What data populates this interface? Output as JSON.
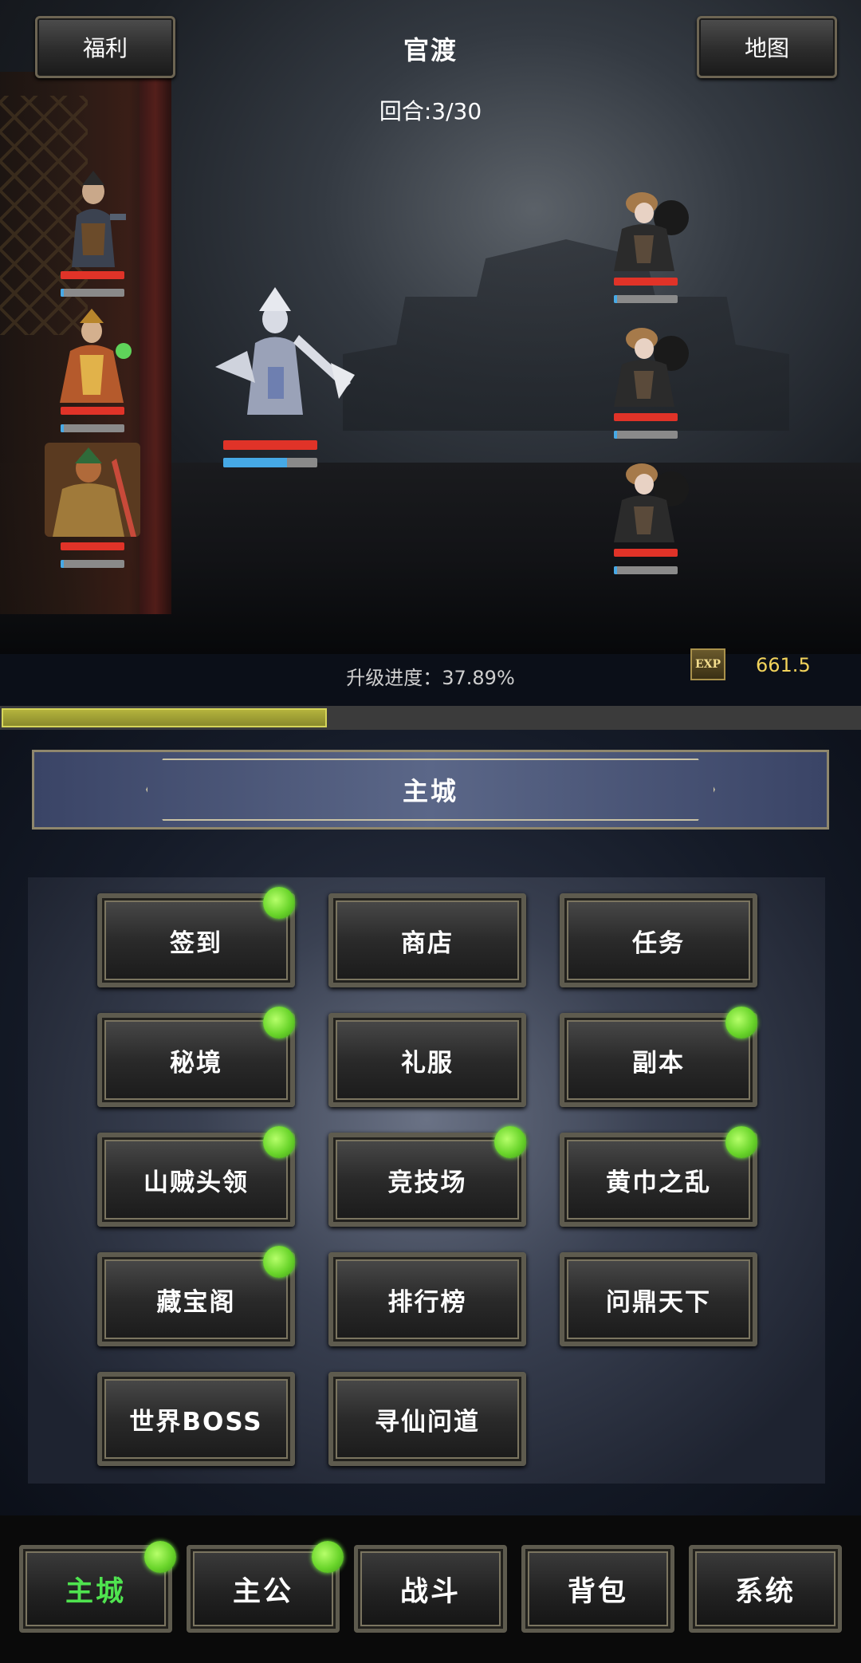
{
  "header": {
    "left_button": "福利",
    "title": "官渡",
    "round": "回合:3/30",
    "right_button": "地图"
  },
  "battle": {
    "left_units": [
      {
        "hp": 1.0,
        "mp": 0.05
      },
      {
        "hp": 1.0,
        "mp": 0.05
      },
      {
        "hp": 1.0,
        "mp": 0.05
      }
    ],
    "main_unit": {
      "hp": 1.0,
      "mp": 0.68
    },
    "right_units": [
      {
        "hp": 1.0,
        "mp": 0.05
      },
      {
        "hp": 1.0,
        "mp": 0.05
      },
      {
        "hp": 1.0,
        "mp": 0.05
      }
    ]
  },
  "progress": {
    "label": "升级进度：37.89%",
    "fraction": 0.3789,
    "exp_icon_text": "EXP",
    "exp_value": "661.5"
  },
  "panel": {
    "title": "主城",
    "buttons": [
      {
        "label": "签到",
        "badge": true
      },
      {
        "label": "商店",
        "badge": false
      },
      {
        "label": "任务",
        "badge": false
      },
      {
        "label": "秘境",
        "badge": true
      },
      {
        "label": "礼服",
        "badge": false
      },
      {
        "label": "副本",
        "badge": true
      },
      {
        "label": "山贼头领",
        "badge": true
      },
      {
        "label": "竞技场",
        "badge": true
      },
      {
        "label": "黄巾之乱",
        "badge": true
      },
      {
        "label": "藏宝阁",
        "badge": true
      },
      {
        "label": "排行榜",
        "badge": false
      },
      {
        "label": "问鼎天下",
        "badge": false
      },
      {
        "label": "世界BOSS",
        "badge": false
      },
      {
        "label": "寻仙问道",
        "badge": false
      }
    ]
  },
  "nav": {
    "items": [
      {
        "label": "主城",
        "active": true,
        "badge": true
      },
      {
        "label": "主公",
        "active": false,
        "badge": true
      },
      {
        "label": "战斗",
        "active": false,
        "badge": false
      },
      {
        "label": "背包",
        "active": false,
        "badge": false
      },
      {
        "label": "系统",
        "active": false,
        "badge": false
      }
    ]
  },
  "colors": {
    "hp": "#e03328",
    "mp": "#46a9e6",
    "badge": "#6ad52b",
    "active_nav": "#4fe34f",
    "exp_value": "#f2d35b"
  }
}
